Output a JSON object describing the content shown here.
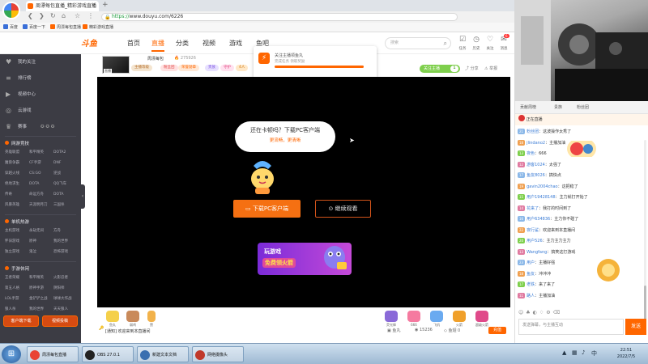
{
  "browser": {
    "tab_title": "周漂每包直播_精彩游戏直播",
    "url_scheme": "https://",
    "url_host": "www.douyu.com",
    "url_path": "/6226",
    "bookmarks": [
      "百度",
      "百度一下",
      "周漂每包直播",
      "精彩游戏直播"
    ]
  },
  "site": {
    "logo": "斗鱼",
    "nav": [
      "首页",
      "直播",
      "分类",
      "视频",
      "游戏",
      "鱼吧"
    ],
    "active_nav": "直播",
    "search_placeholder": "搜索",
    "header_icons": [
      {
        "icon": "task-icon",
        "label": "任务"
      },
      {
        "icon": "history-icon",
        "label": "历史"
      },
      {
        "icon": "follow-icon",
        "label": "关注"
      },
      {
        "icon": "message-icon",
        "label": "消息"
      }
    ],
    "message_badge": "6"
  },
  "sidebar": {
    "items": [
      {
        "icon": "heart-icon",
        "label": "我的关注"
      },
      {
        "icon": "list-icon",
        "label": "排行榜"
      },
      {
        "icon": "video-icon",
        "label": "视频中心"
      },
      {
        "icon": "game-icon",
        "label": "云游戏"
      },
      {
        "icon": "esports-icon",
        "label": "赛事"
      }
    ],
    "section_online": "网游竞技",
    "online_games": [
      "英雄联盟",
      "和平精英",
      "DOTA2",
      "魔兽争霸",
      "CF手游",
      "DNF",
      "穿越火线",
      "CS:GO",
      "逆战",
      "绝地求生",
      "DOTA",
      "QQ飞车",
      "传奇",
      "命运方舟",
      "DOTA",
      "风暴英雄",
      "天涯明月刀",
      "三国杀"
    ],
    "section_single": "单机热游",
    "single_games": [
      "主机游戏",
      "永劫无间",
      "方舟",
      "怀旧游戏",
      "原神",
      "我的世界",
      "独立游戏",
      "鬼泣",
      "恐怖游戏"
    ],
    "section_mobile": "手游休闲",
    "mobile_games": [
      "王者荣耀",
      "和平精英",
      "火影忍者",
      "第五人格",
      "原神手游",
      "阴阳师",
      "LOL手游",
      "金铲铲之战",
      "球球大作战",
      "狼人杀",
      "我的世界",
      "天天狼人"
    ],
    "btn_client": "客户端下载",
    "btn_video": "视频投稿"
  },
  "room": {
    "anchor": "周漂每包",
    "hot": "275926",
    "avatar_badge": "直播",
    "pills": [
      "主播等级",
      "粉丝团",
      "荣誉勋章",
      "贵族",
      "守护",
      "4人"
    ],
    "promo_title": "关注主播领鱼丸",
    "promo_sub": "完成任务 领取奖励",
    "promo_progress": 1.0,
    "follow_label": "关注主播",
    "follow_count": "1",
    "share": "分享",
    "report": "举报"
  },
  "player": {
    "bubble_question": "还在卡顿吗？下载PC客户端",
    "bubble_sub": "更流畅，更清晰",
    "download_btn": "下载PC客户端",
    "watch_btn": "继续观看",
    "game_banner_l1": "玩游戏",
    "game_banner_l2": "免费领火箭"
  },
  "gifts": {
    "items": [
      "鱼丸",
      "弱鸡",
      "赞",
      "荧光棒",
      "666",
      "飞机",
      "火箭",
      "超级火箭"
    ],
    "barrage_tip": "[通知] 欢迎来到本直播间",
    "fish_label": "鱼丸",
    "fish_count": "15236",
    "balance_label": "鱼翅",
    "balance_count": "0",
    "recharge": "充值"
  },
  "chat": {
    "rank_tabs": [
      "贡献周榜",
      "贵族",
      "粉丝团"
    ],
    "fans_row": "正在直播",
    "messages": [
      {
        "lv": "21",
        "nick": "粉丝团",
        "text": "这波操作太秀了"
      },
      {
        "lv": "18",
        "nick": "jlindano2",
        "text": "主播加油"
      },
      {
        "lv": "13",
        "nick": "夜色",
        "text": "666"
      },
      {
        "lv": "12",
        "nick": "游客1024",
        "text": "太强了"
      },
      {
        "lv": "17",
        "nick": "鱼友8026",
        "text": "搞快点"
      },
      {
        "lv": "19",
        "nick": "gavin2004chao",
        "text": "这把稳了"
      },
      {
        "lv": "15",
        "nick": "用户19428148",
        "text": "主力就打开始了"
      },
      {
        "lv": "14",
        "nick": "花来了",
        "text": "我打的时间到了"
      },
      {
        "lv": "16",
        "nick": "用户634836",
        "text": "主力你不碰了"
      },
      {
        "lv": "22",
        "nick": "夜行鲨",
        "text": "欢迎来到本直播间"
      },
      {
        "lv": "20",
        "nick": "用户526",
        "text": "主力主力主力"
      },
      {
        "lv": "13",
        "nick": "Wangfang",
        "text": "搞笑这打游戏"
      },
      {
        "lv": "23",
        "nick": "用户",
        "text": "主播好强"
      },
      {
        "lv": "18",
        "nick": "鱼友",
        "text": "冲冲冲"
      },
      {
        "lv": "17",
        "nick": "老铁",
        "text": "来了来了"
      },
      {
        "lv": "11",
        "nick": "路人",
        "text": "主播加油"
      }
    ],
    "input_placeholder": "发送弹幕，与主播互动",
    "send": "发送"
  },
  "taskbar": {
    "tasks": [
      {
        "label": "周漂每包直播",
        "color": "#e94235"
      },
      {
        "label": "OBS 27.0.1",
        "color": "#222222"
      },
      {
        "label": "新建文本文档",
        "color": "#3a6fb0"
      },
      {
        "label": "网络摄像头",
        "color": "#c0392b"
      }
    ],
    "time": "22:51",
    "date": "2022/7/5"
  },
  "colors": {
    "accent": "#ff6600",
    "sidebar": "#3c3c44",
    "follow_green": "#7ecf4c"
  }
}
